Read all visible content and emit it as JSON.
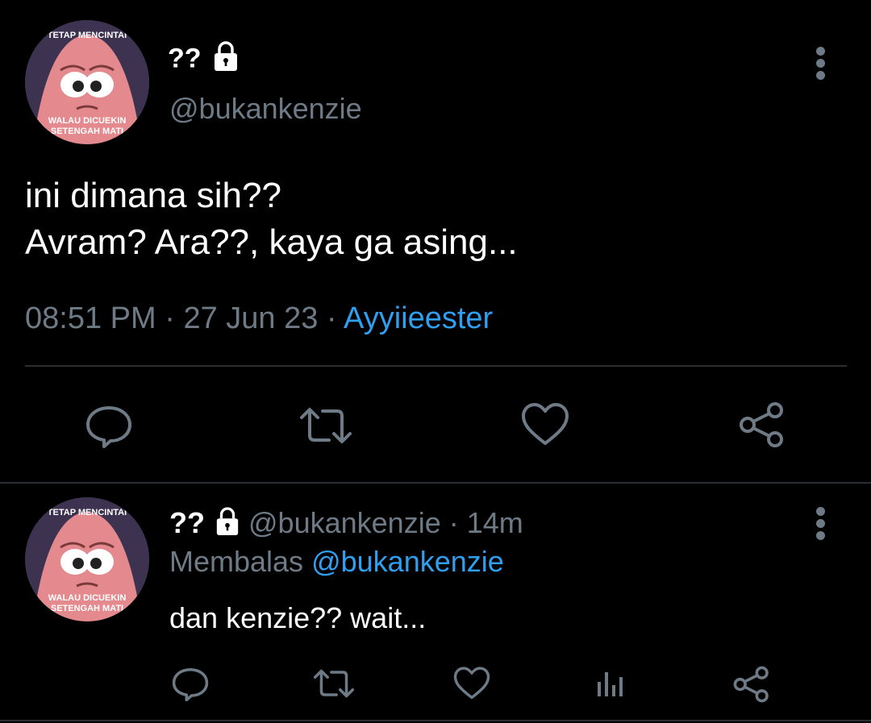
{
  "main_tweet": {
    "display_name": "??",
    "handle": "@bukankenzie",
    "avatar_caption_top": "TETAP MENCINTAI",
    "avatar_caption_bottom_1": "WALAU DICUEKIN",
    "avatar_caption_bottom_2": "SETENGAH MATI",
    "text_line_1": "ini dimana sih??",
    "text_line_2": "Avram? Ara??, kaya ga asing...",
    "time": "08:51 PM",
    "date": "27 Jun 23",
    "source": "Ayyiieester",
    "separator": "·"
  },
  "reply_tweet": {
    "display_name": "??",
    "handle": "@bukankenzie",
    "age": "14m",
    "separator": "·",
    "replying_label": "Membalas",
    "replying_to": "@bukankenzie",
    "text": "dan kenzie?? wait...",
    "avatar_caption_top": "TETAP MENCINTAI",
    "avatar_caption_bottom_1": "WALAU DICUEKIN",
    "avatar_caption_bottom_2": "SETENGAH MATI"
  },
  "icons": {
    "lock": "lock-icon",
    "more": "more-vertical-icon",
    "reply": "reply-icon",
    "retweet": "retweet-icon",
    "like": "heart-icon",
    "share": "share-icon",
    "analytics": "analytics-icon"
  },
  "colors": {
    "background": "#000000",
    "muted": "#6e7b87",
    "link": "#2f9ff0",
    "divider": "#2a2e33"
  }
}
